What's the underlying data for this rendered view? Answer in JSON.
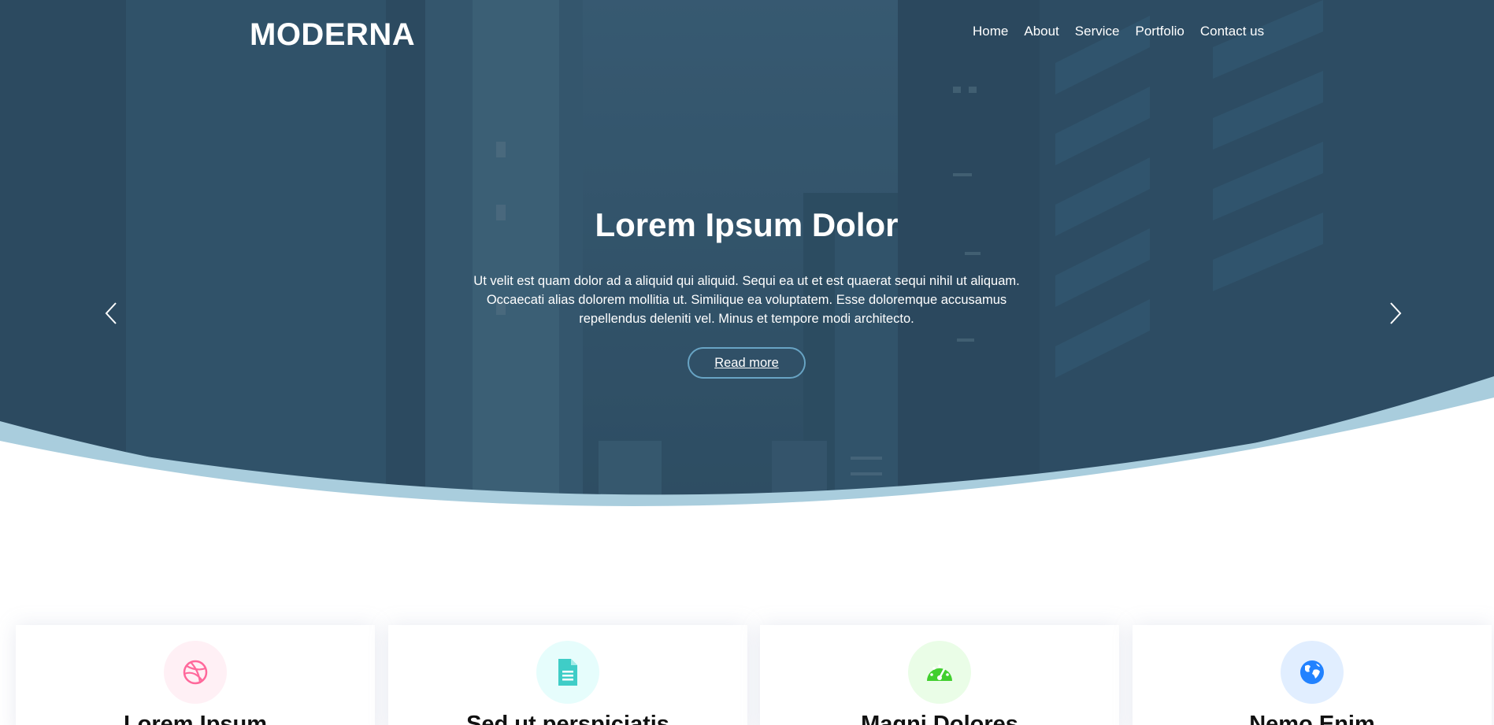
{
  "brand": {
    "name": "MODERNA"
  },
  "nav": {
    "items": [
      {
        "label": "Home"
      },
      {
        "label": "About"
      },
      {
        "label": "Service"
      },
      {
        "label": "Portfolio"
      },
      {
        "label": "Contact us"
      }
    ]
  },
  "hero": {
    "title": "Lorem Ipsum Dolor",
    "text": "Ut velit est quam dolor ad a aliquid qui aliquid. Sequi ea ut et est quaerat sequi nihil ut aliquam. Occaecati alias dolorem mollitia ut. Similique ea voluptatem. Esse doloremque accusamus repellendus deleniti vel. Minus et tempore modi architecto.",
    "button_label": "Read more",
    "prev_icon": "chevron-left-icon",
    "next_icon": "chevron-right-icon"
  },
  "services": [
    {
      "title": "Lorem Ipsum",
      "icon": "dribbble-icon",
      "color": "#ff689b",
      "bg": "#fff0f5"
    },
    {
      "title": "Sed ut perspiciatis",
      "icon": "file-text-icon",
      "color": "#3fcdc7",
      "bg": "#e6fdfc"
    },
    {
      "title": "Magni Dolores",
      "icon": "tachometer-icon",
      "color": "#41cf2e",
      "bg": "#eafde7"
    },
    {
      "title": "Nemo Enim",
      "icon": "world-icon",
      "color": "#2282ff",
      "bg": "#e1eeff"
    }
  ],
  "colors": {
    "hero_overlay": "#2c4b62",
    "wave": "#a9cddd",
    "accent": "#68a4c4"
  }
}
